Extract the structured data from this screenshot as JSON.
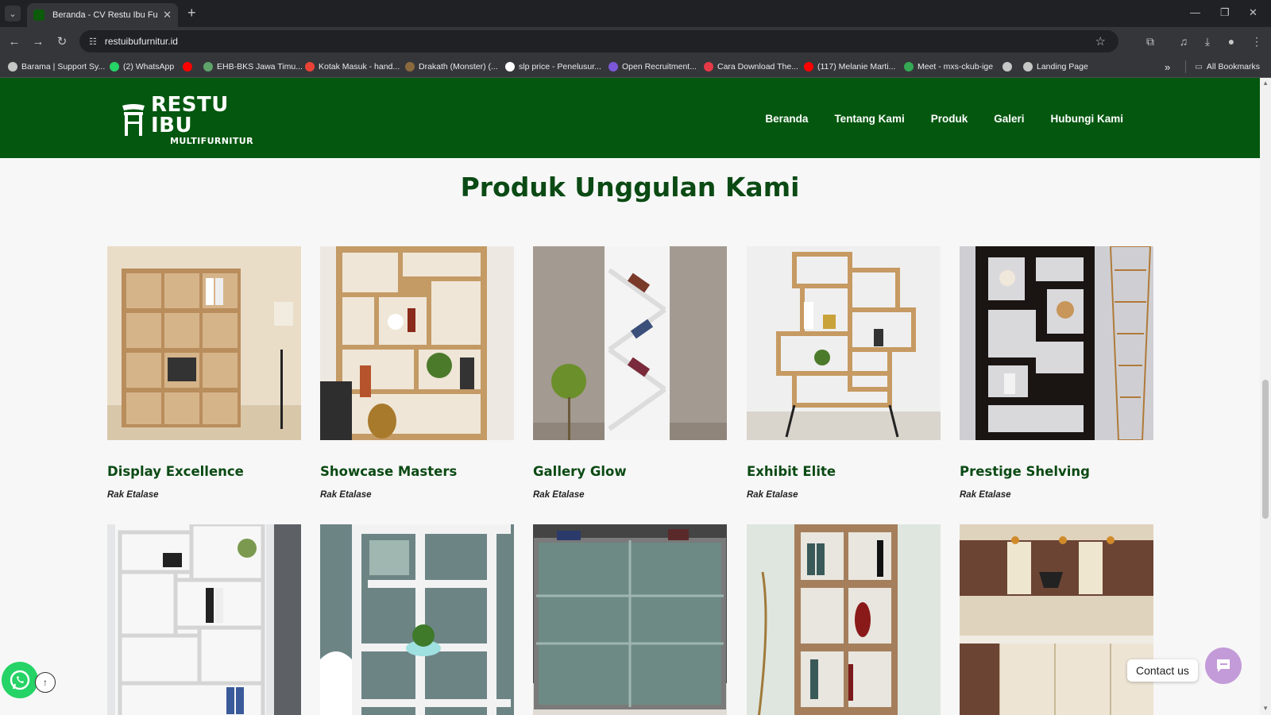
{
  "browser": {
    "tab_title": "Beranda - CV Restu Ibu Furnitu",
    "url": "restuibufurnitur.id",
    "bookmarks": [
      {
        "label": "Barama | Support Sy...",
        "color": "#c4c7c5"
      },
      {
        "label": "(2) WhatsApp",
        "color": "#25d366"
      },
      {
        "label": "",
        "color": "#ff0000"
      },
      {
        "label": "EHB-BKS Jawa Timu...",
        "color": "#5fa36b"
      },
      {
        "label": "Kotak Masuk - hand...",
        "color": "#ea4335"
      },
      {
        "label": "Drakath (Monster) (...",
        "color": "#8a6a3c"
      },
      {
        "label": "slp price - Penelusur...",
        "color": "#ffffff"
      },
      {
        "label": "Open Recruitment...",
        "color": "#7b57d8"
      },
      {
        "label": "Cara Download The...",
        "color": "#e63946"
      },
      {
        "label": "(117) Melanie Marti...",
        "color": "#ff0000"
      },
      {
        "label": "Meet - mxs-ckub-ige",
        "color": "#34a853"
      },
      {
        "label": "",
        "color": "#c4c7c5"
      },
      {
        "label": "Landing Page",
        "color": "#c4c7c5"
      }
    ],
    "all_bookmarks": "All Bookmarks"
  },
  "site": {
    "logo_main": "RESTU IBU",
    "logo_sub": "MULTIFURNITUR",
    "nav": [
      "Beranda",
      "Tentang Kami",
      "Produk",
      "Galeri",
      "Hubungi Kami"
    ],
    "section_title": "Produk Unggulan Kami",
    "products": [
      {
        "name": "Display Excellence",
        "category": "Rak Etalase"
      },
      {
        "name": "Showcase Masters",
        "category": "Rak Etalase"
      },
      {
        "name": "Gallery Glow",
        "category": "Rak Etalase"
      },
      {
        "name": "Exhibit Elite",
        "category": "Rak Etalase"
      },
      {
        "name": "Prestige Shelving",
        "category": "Rak Etalase"
      }
    ],
    "contact_label": "Contact us"
  },
  "colors": {
    "header_green": "#04570f",
    "title_green": "#0b4a14",
    "whatsapp": "#25d366",
    "contact_purple": "#c39bd9"
  }
}
